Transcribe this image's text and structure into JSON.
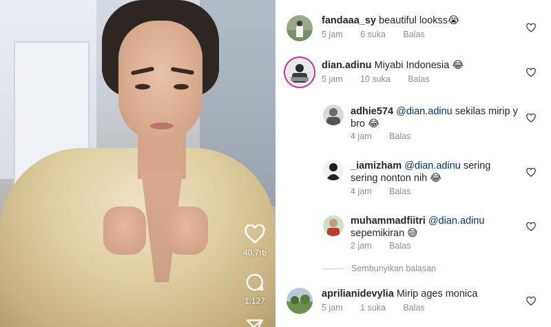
{
  "video": {
    "likes_count": "40,7rb",
    "comments_count": "1.127"
  },
  "comments": [
    {
      "username": "fandaaa_sy",
      "text": "beautiful lookss😭",
      "time": "5 jam",
      "likes": "6 suka",
      "reply_label": "Balas"
    },
    {
      "username": "dian.adinu",
      "text": "Miyabi Indonesia 😂",
      "time": "5 jam",
      "likes": "10 suka",
      "reply_label": "Balas"
    }
  ],
  "replies": [
    {
      "username": "adhie574",
      "mention": "@dian.adinu",
      "text": "sekilas mirip y bro 😂",
      "time": "4 jam",
      "reply_label": "Balas"
    },
    {
      "username": "_iamizham",
      "mention": "@dian.adinu",
      "text": "sering sering nonton nih 😂",
      "time": "4 jam",
      "reply_label": "Balas"
    },
    {
      "username": "muhammadfiitri",
      "mention": "@dian.adinu",
      "text": "sepemikiran 😅",
      "time": "2 jam",
      "reply_label": "Balas"
    }
  ],
  "hide_replies_label": "Sembunyikan balasan",
  "last_comment": {
    "username": "aprilianidevylia",
    "text": "Mirip ages monica",
    "time": "5 jam",
    "likes": "1 suka",
    "reply_label": "Balas"
  },
  "colors": {
    "mention": "#00376b",
    "meta": "#8e8e8e",
    "story_ring": "#d6249f"
  },
  "icons": [
    "heart-icon",
    "comment-bubble-icon",
    "share-icon",
    "heart-outline-icon"
  ]
}
